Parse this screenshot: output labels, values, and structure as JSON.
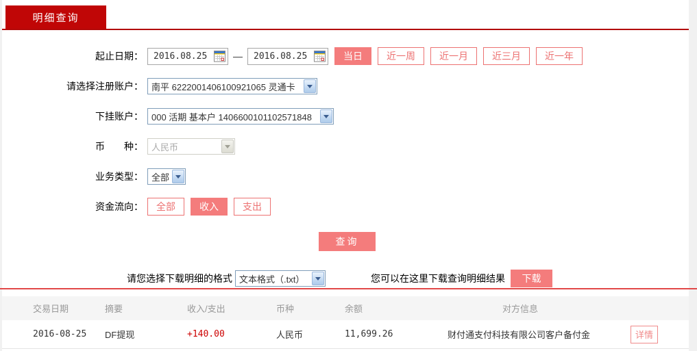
{
  "tab": {
    "label": "明细查询"
  },
  "form": {
    "date_row": {
      "label": "起止日期：",
      "start_date": "2016.08.25",
      "end_date": "2016.08.25",
      "separator": "—",
      "quick_buttons": [
        {
          "label": "当日",
          "active": true
        },
        {
          "label": "近一周",
          "active": false
        },
        {
          "label": "近一月",
          "active": false
        },
        {
          "label": "近三月",
          "active": false
        },
        {
          "label": "近一年",
          "active": false
        }
      ]
    },
    "register_account": {
      "label": "请选择注册账户：",
      "value": "南平 6222001406100921065 灵通卡"
    },
    "sub_account": {
      "label": "下挂账户：",
      "value": "000 活期 基本户 1406600101102571848"
    },
    "currency": {
      "label": "币　　种：",
      "value": "人民币",
      "disabled": true
    },
    "business_type": {
      "label": "业务类型：",
      "value": "全部"
    },
    "fund_flow": {
      "label": "资金流向：",
      "buttons": [
        {
          "label": "全部",
          "active": false
        },
        {
          "label": "收入",
          "active": true
        },
        {
          "label": "支出",
          "active": false
        }
      ]
    },
    "query_button": "查询"
  },
  "download": {
    "format_label": "请您选择下载明细的格式",
    "format_value": "文本格式（.txt）",
    "hint": "您可以在这里下载查询明细结果",
    "button": "下载"
  },
  "table": {
    "headers": [
      "交易日期",
      "摘要",
      "收入/支出",
      "币种",
      "余额",
      "对方信息"
    ],
    "rows": [
      {
        "date": "2016-08-25",
        "summary": "DF提现",
        "amount": "+140.00",
        "currency": "人民币",
        "balance": "11,699.26",
        "counterparty": "财付通支付科技有限公司客户备付金",
        "action": "详情"
      }
    ]
  },
  "colors": {
    "tab_red": "#c00606",
    "accent_pink": "#f47c7c",
    "outline_pink": "#ec7171",
    "separator_red": "#e14747",
    "amount_red": "#cc0000"
  }
}
